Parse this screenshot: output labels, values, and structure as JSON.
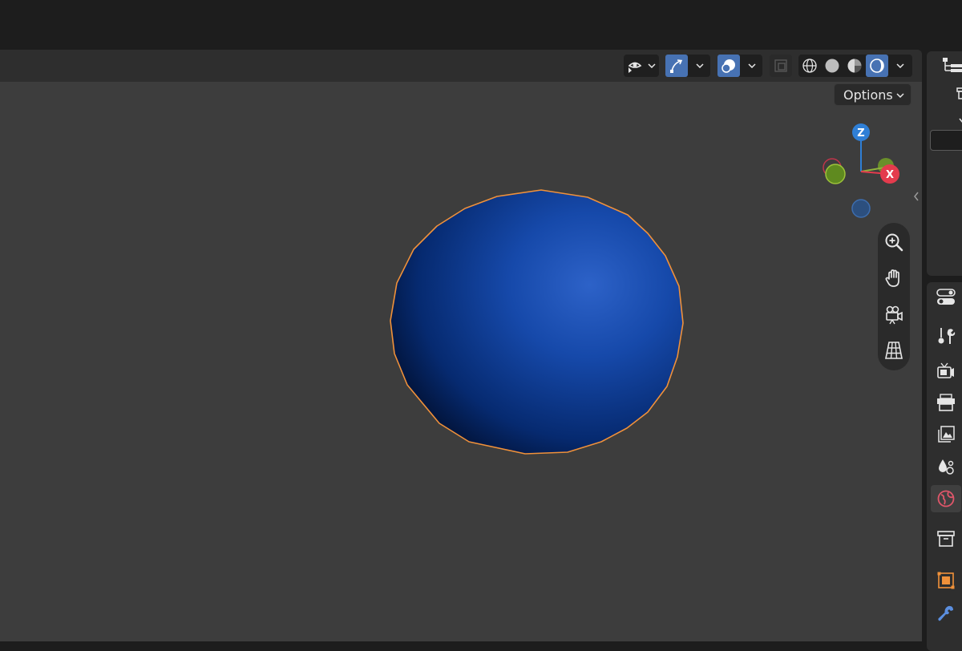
{
  "header": {
    "options_label": "Options"
  },
  "gizmo": {
    "z_label": "Z",
    "x_label": "X",
    "y_label": "Y"
  },
  "viewport": {
    "sphere_color": "#1a4fb0",
    "outline_color": "#f0913a",
    "background": "#3d3d3d"
  },
  "navigation": [
    "zoom-icon",
    "pan-hand-icon",
    "camera-view-icon",
    "ortho-grid-icon"
  ],
  "properties_tabs": [
    "tool-icon",
    "render-icon",
    "output-icon",
    "view-layer-icon",
    "scene-icon",
    "world-icon",
    "collection-icon",
    "object-icon",
    "modifier-icon"
  ]
}
